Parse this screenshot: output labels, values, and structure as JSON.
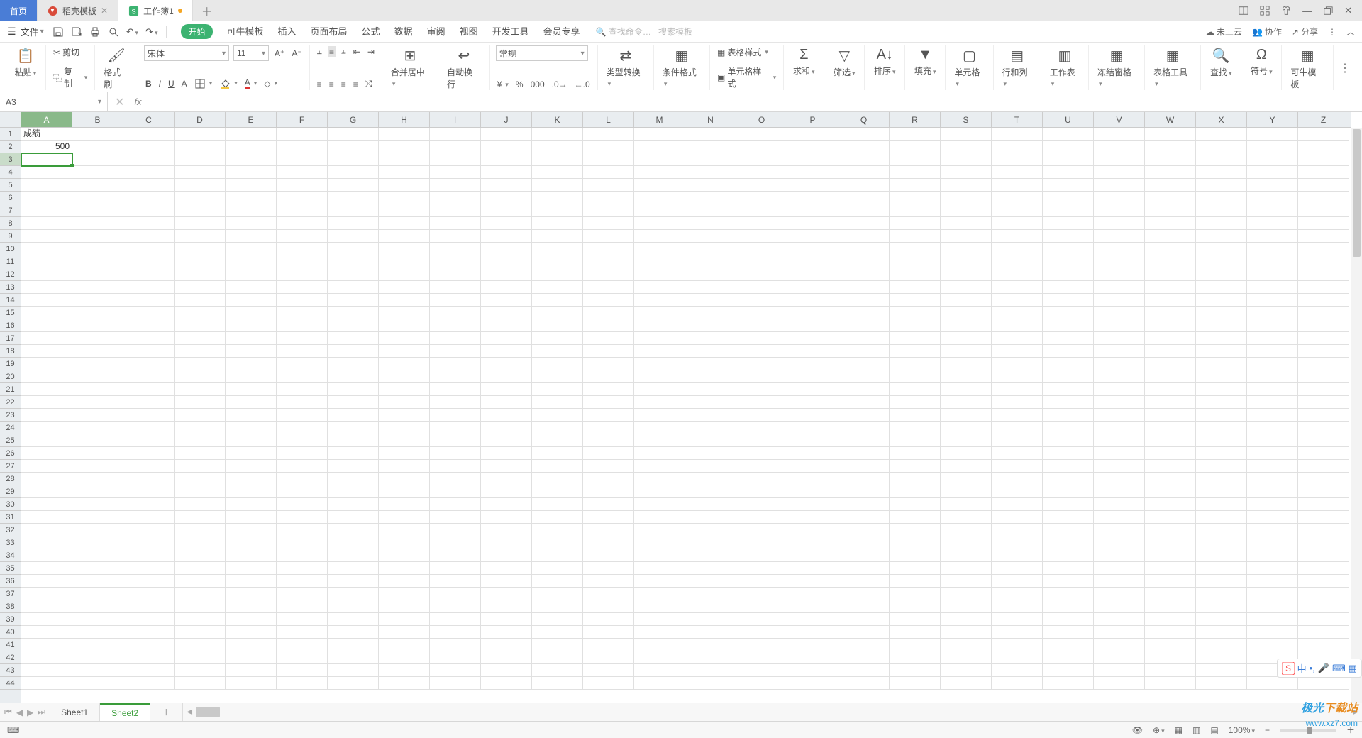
{
  "tabs": {
    "home": "首页",
    "t1": "稻壳模板",
    "t2": "工作簿1"
  },
  "menu": {
    "file": "文件",
    "items": [
      "开始",
      "可牛模板",
      "插入",
      "页面布局",
      "公式",
      "数据",
      "审阅",
      "视图",
      "开发工具",
      "会员专享"
    ],
    "search_cmd": "查找命令…",
    "search_tpl": "搜索模板",
    "right": {
      "cloud": "未上云",
      "coop": "协作",
      "share": "分享"
    }
  },
  "ribbon": {
    "paste": "粘贴",
    "cut": "剪切",
    "copy": "复制",
    "brush": "格式刷",
    "font": "宋体",
    "size": "11",
    "merge": "合并居中",
    "wrap": "自动换行",
    "numfmt": "常规",
    "typeconv": "类型转换",
    "condfmt": "条件格式",
    "tablestyle": "表格样式",
    "cellstyle": "单元格样式",
    "sum": "求和",
    "filter": "筛选",
    "sort": "排序",
    "fill": "填充",
    "cells": "单元格",
    "rowscols": "行和列",
    "worksheet": "工作表",
    "freeze": "冻结窗格",
    "tabletool": "表格工具",
    "find": "查找",
    "symbol": "符号",
    "keniu": "可牛模板"
  },
  "namebox": "A3",
  "columns": [
    "A",
    "B",
    "C",
    "D",
    "E",
    "F",
    "G",
    "H",
    "I",
    "J",
    "K",
    "L",
    "M",
    "N",
    "O",
    "P",
    "Q",
    "R",
    "S",
    "T",
    "U",
    "V",
    "W",
    "X",
    "Y",
    "Z"
  ],
  "rowcount": 44,
  "cells": {
    "A1": "成绩",
    "A2": "500"
  },
  "selected": {
    "col": 0,
    "row": 2
  },
  "sheets": {
    "s1": "Sheet1",
    "s2": "Sheet2"
  },
  "status": {
    "zoom": "100%"
  },
  "watermark": {
    "a": "极光",
    "b": "下载站",
    "url": "www.xz7.com"
  },
  "ime": "中"
}
